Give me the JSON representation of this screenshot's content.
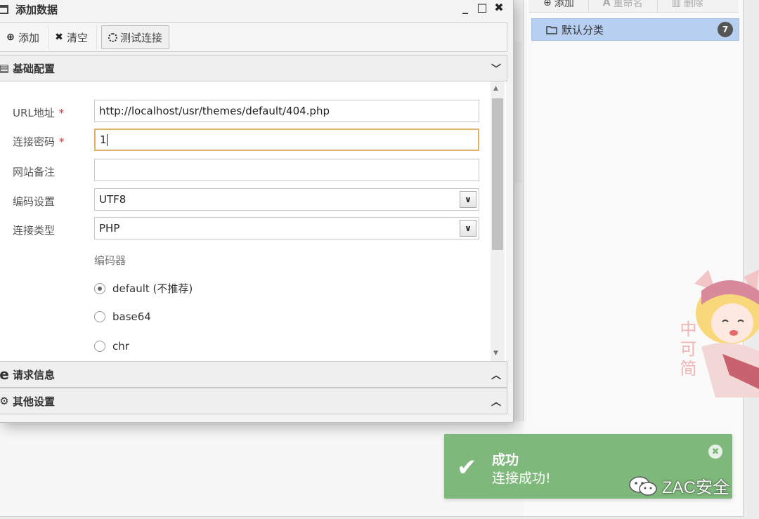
{
  "right_panel": {
    "toolbar": [
      {
        "icon": "plus-circle-icon",
        "label": "添加"
      },
      {
        "icon": "rename-icon",
        "label": "重命名"
      },
      {
        "icon": "trash-icon",
        "label": "删除"
      }
    ],
    "category": {
      "label": "默认分类",
      "count": "7"
    }
  },
  "dialog": {
    "title": "添加数据",
    "window_controls": {
      "minimize": "_",
      "maximize": "□",
      "close": "✖"
    },
    "toolbar": {
      "add": "添加",
      "clear": "清空",
      "test": "测试连接"
    },
    "sections": {
      "basic": "基础配置",
      "request": "请求信息",
      "other": "其他设置"
    },
    "form": {
      "url_label": "URL地址",
      "url_value": "http://localhost/usr/themes/default/404.php",
      "password_label": "连接密码",
      "password_value": "1",
      "note_label": "网站备注",
      "note_value": "",
      "encoding_label": "编码设置",
      "encoding_value": "UTF8",
      "type_label": "连接类型",
      "type_value": "PHP",
      "required_mark": "*",
      "encoder_title": "编码器",
      "encoders": [
        {
          "label": "default (不推荐)",
          "checked": true
        },
        {
          "label": "base64",
          "checked": false
        },
        {
          "label": "chr",
          "checked": false
        }
      ]
    }
  },
  "toast": {
    "title": "成功",
    "message": "连接成功!",
    "color": "#7fb87b"
  },
  "watermark": "ZAC安全",
  "mascot_text": "中可简"
}
